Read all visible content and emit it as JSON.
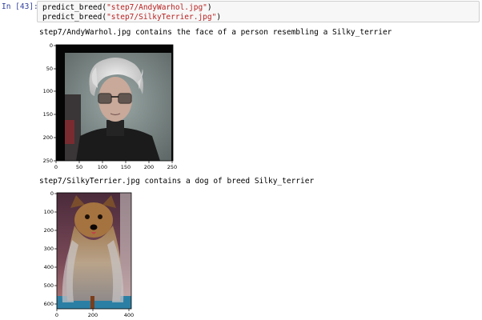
{
  "cell": {
    "prompt": "In [43]:",
    "code_lines": [
      {
        "fn": "predict_breed(",
        "arg": "\"step7/AndyWarhol.jpg\"",
        "end": ")"
      },
      {
        "fn": "predict_breed(",
        "arg": "\"step7/SilkyTerrier.jpg\"",
        "end": ")"
      }
    ]
  },
  "outputs": [
    {
      "text": "step7/AndyWarhol.jpg contains the face of a person resembling a Silky_terrier",
      "image_description": "portrait-photo",
      "x_ticks": [
        "0",
        "50",
        "100",
        "150",
        "200",
        "250"
      ],
      "y_ticks": [
        "0",
        "50",
        "100",
        "150",
        "200",
        "250"
      ]
    },
    {
      "text": "step7/SilkyTerrier.jpg contains a dog of breed Silky_terrier",
      "image_description": "dog-photo",
      "x_ticks": [
        "0",
        "200",
        "400"
      ],
      "y_ticks": [
        "0",
        "100",
        "200",
        "300",
        "400",
        "500",
        "600"
      ]
    }
  ],
  "colors": {
    "prompt": "#303f9f",
    "string": "#ba2121",
    "input_bg": "#f7f7f7"
  }
}
